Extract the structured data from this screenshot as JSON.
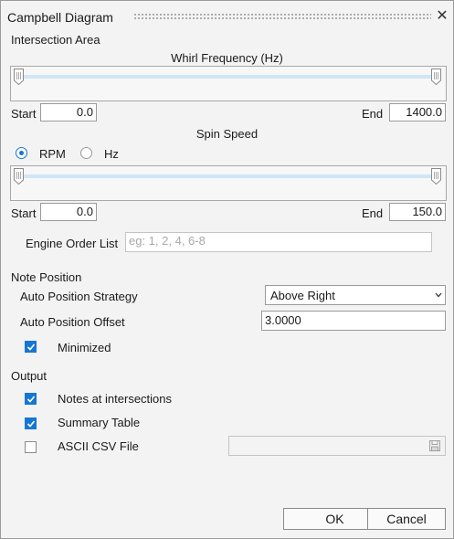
{
  "window": {
    "title": "Campbell Diagram",
    "close_glyph": "✕"
  },
  "intersection_area": {
    "heading": "Intersection Area",
    "whirl": {
      "label": "Whirl Frequency (Hz)",
      "start_label": "Start",
      "start_value": "0.0",
      "end_label": "End",
      "end_value": "1400.0",
      "range_fraction": [
        0,
        1
      ]
    },
    "spin": {
      "label": "Spin Speed",
      "unit_options": [
        {
          "label": "RPM",
          "selected": true
        },
        {
          "label": "Hz",
          "selected": false
        }
      ],
      "start_label": "Start",
      "start_value": "0.0",
      "end_label": "End",
      "end_value": "150.0",
      "range_fraction": [
        0,
        1
      ]
    },
    "engine_order": {
      "label": "Engine Order List",
      "value": "",
      "placeholder": "eg: 1, 2, 4, 6-8"
    }
  },
  "note_position": {
    "heading": "Note Position",
    "strategy_label": "Auto Position Strategy",
    "strategy_value": "Above Right",
    "offset_label": "Auto Position Offset",
    "offset_value": "3.0000",
    "minimized_label": "Minimized",
    "minimized_checked": true
  },
  "output": {
    "heading": "Output",
    "notes_label": "Notes at intersections",
    "notes_checked": true,
    "summary_label": "Summary Table",
    "summary_checked": true,
    "csv_label": "ASCII CSV File",
    "csv_checked": false,
    "csv_path": ""
  },
  "buttons": {
    "ok": "OK",
    "cancel": "Cancel"
  },
  "colors": {
    "accent": "#1677d2",
    "track": "#cfe6f7",
    "dialog_bg": "#f3f3f3"
  },
  "icons": [
    "close-icon",
    "slider-thumb-icon",
    "checkmark-icon",
    "chevron-down-icon",
    "save-icon"
  ]
}
